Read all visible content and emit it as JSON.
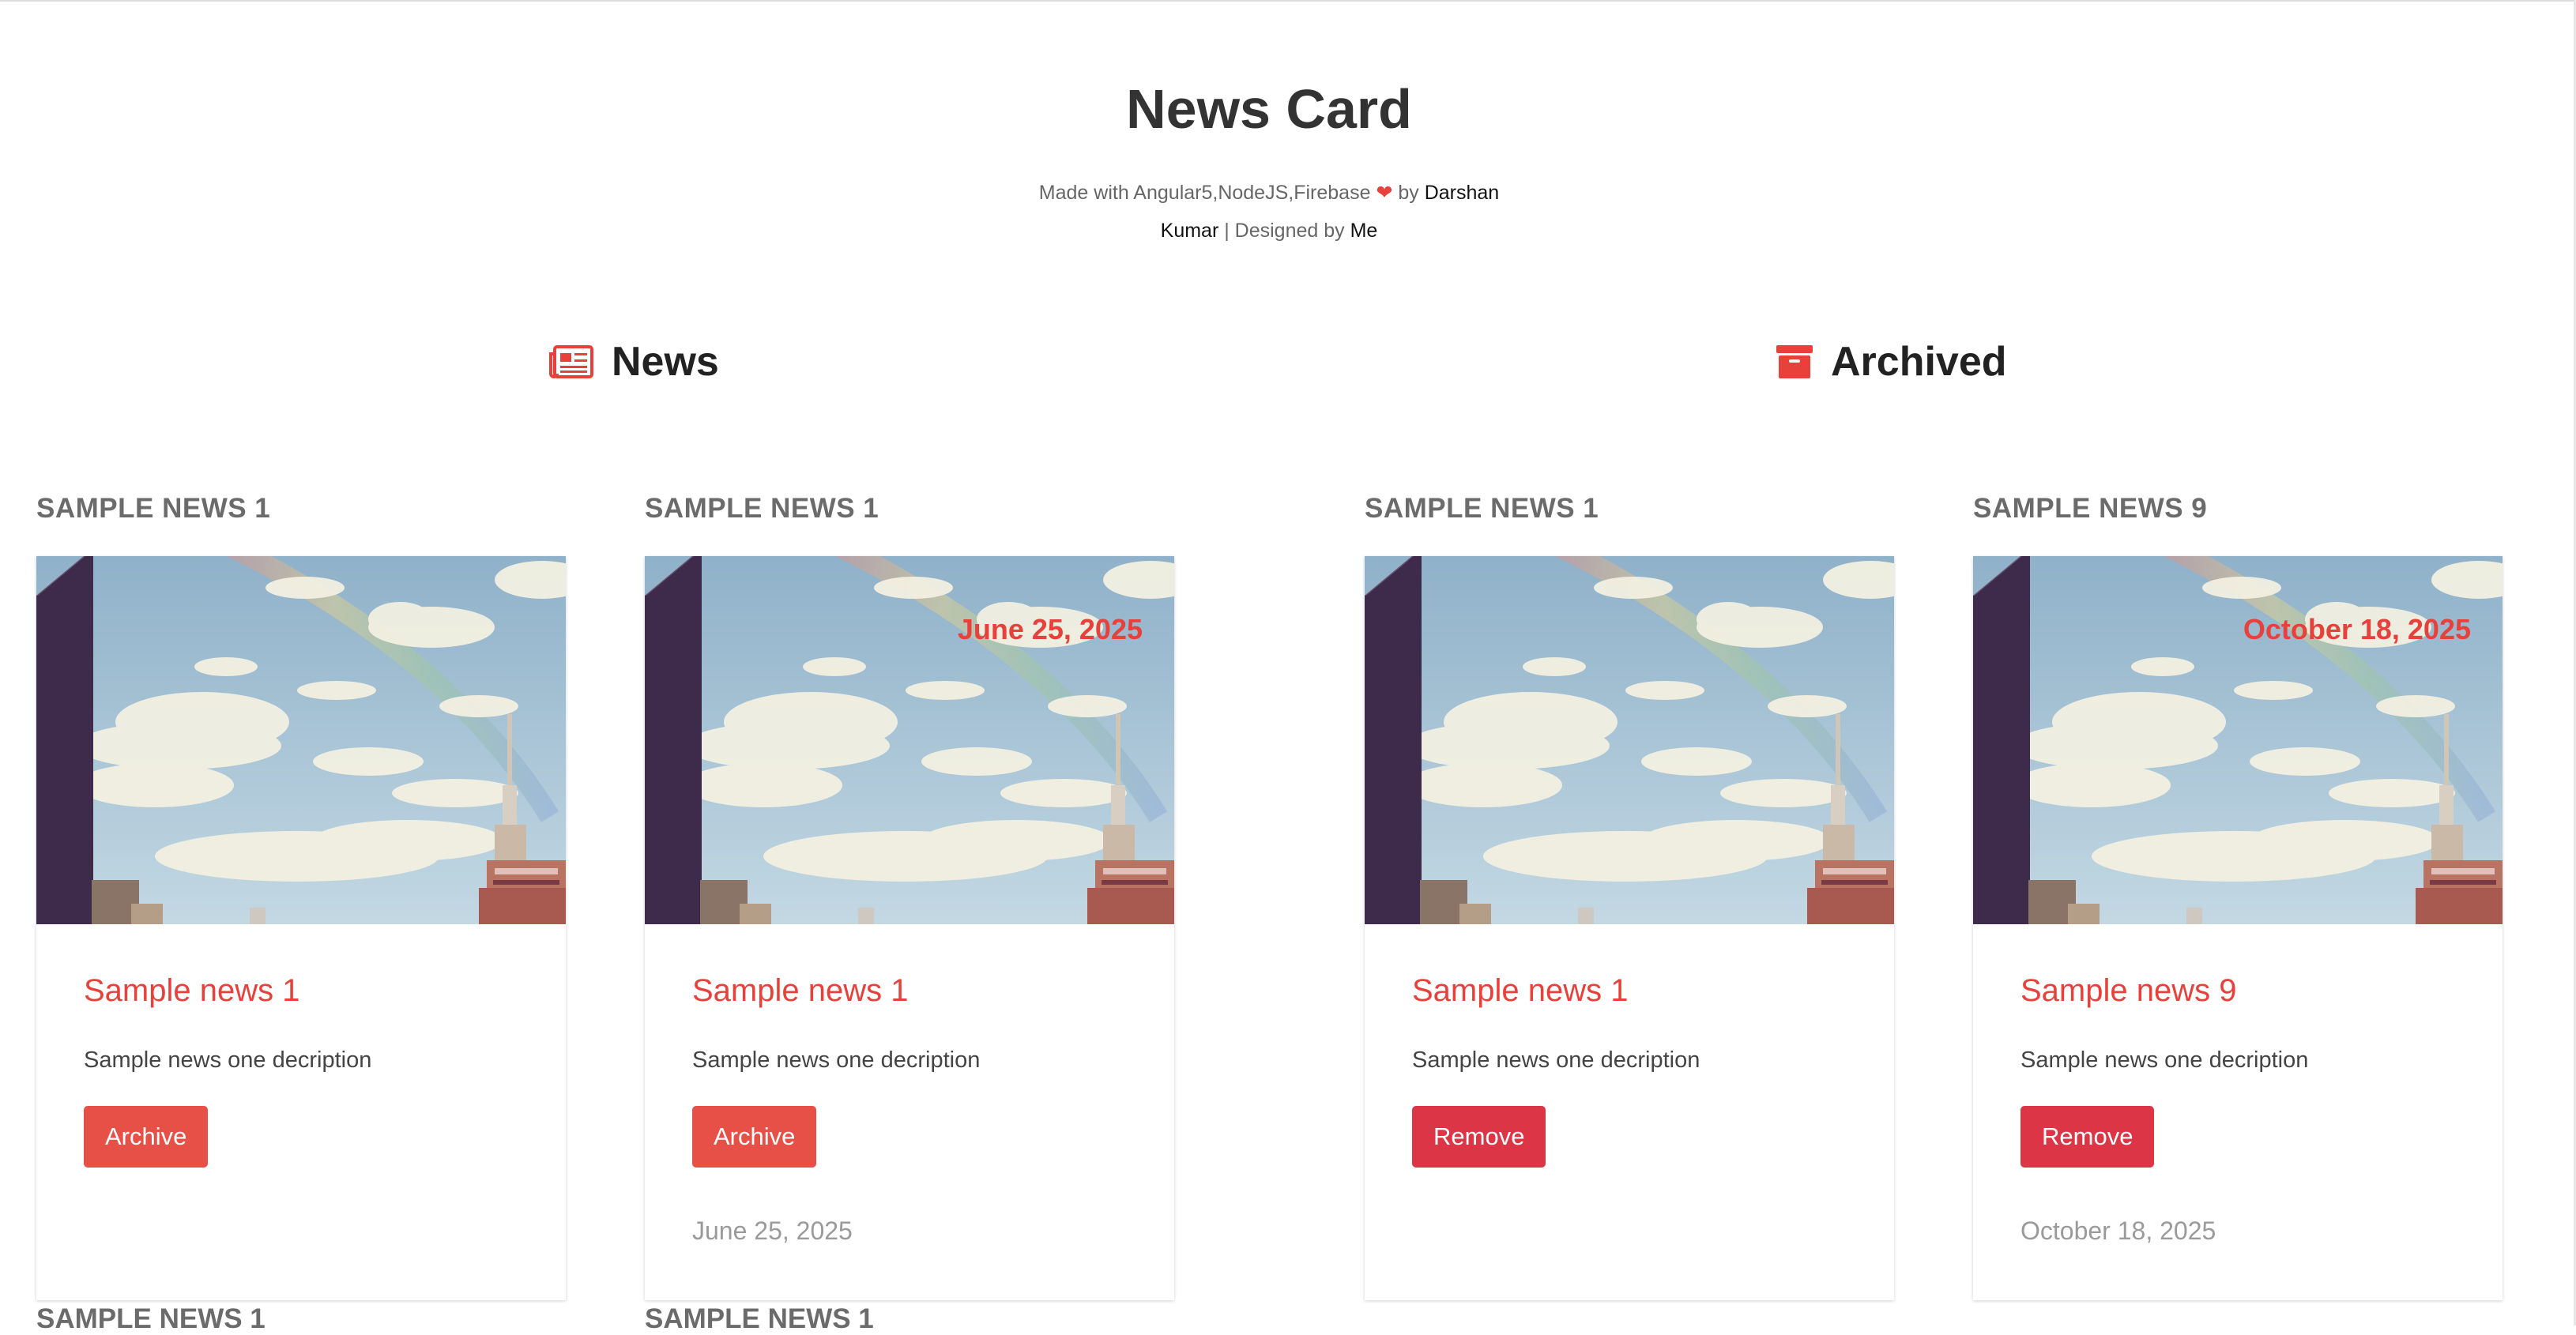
{
  "page": {
    "title": "News Card",
    "credits": {
      "prefix": "Made with Angular5,NodeJS,Firebase",
      "heart": "❤",
      "by": "by",
      "author": "Darshan Kumar",
      "designed_by": "| Designed by",
      "designer": "Me"
    }
  },
  "sections": {
    "news": {
      "title": "News",
      "icon": "newspaper-icon"
    },
    "archived": {
      "title": "Archived",
      "icon": "archive-box-icon"
    }
  },
  "colors": {
    "accent": "#e8403a",
    "archive_button": "#e65047",
    "remove_button": "#dc3545",
    "heading_gray": "#6b6b6b"
  },
  "news_cards": [
    {
      "heading": "SAMPLE NEWS 1",
      "image_date": "",
      "title": "Sample news 1",
      "description": "Sample news one decription",
      "button": "Archive",
      "date": ""
    },
    {
      "heading": "SAMPLE NEWS 1",
      "image_date": "June 25, 2025",
      "title": "Sample news 1",
      "description": "Sample news one decription",
      "button": "Archive",
      "date": "June 25, 2025"
    }
  ],
  "archived_cards": [
    {
      "heading": "SAMPLE NEWS 1",
      "image_date": "",
      "title": "Sample news 1",
      "description": "Sample news one decription",
      "button": "Remove",
      "date": ""
    },
    {
      "heading": "SAMPLE NEWS 9",
      "image_date": "October 18, 2025",
      "title": "Sample news 9",
      "description": "Sample news one decription",
      "button": "Remove",
      "date": "October 18, 2025"
    }
  ],
  "next_row": [
    "SAMPLE NEWS 1",
    "SAMPLE NEWS 1"
  ]
}
